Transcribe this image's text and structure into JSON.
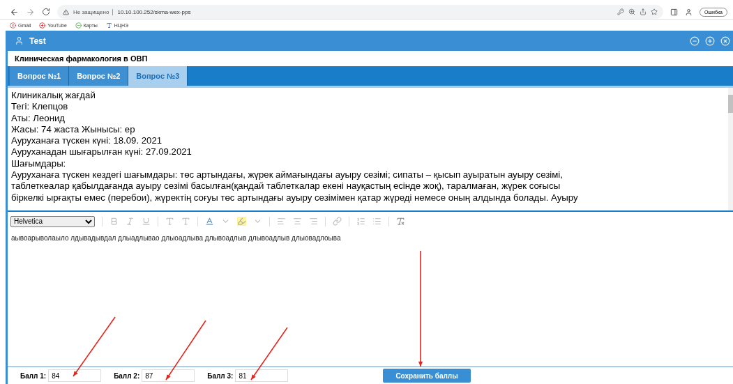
{
  "browser": {
    "security": "Не защищено",
    "url": "10.10.100.252/skma-wex-pps",
    "bookmarks": [
      "Gmail",
      "YouTube",
      "Карты",
      "НЦНЭ"
    ],
    "profile_button": "Ошибка"
  },
  "window": {
    "title": "Test"
  },
  "course_title": "Клиническая фармакология в ОВП",
  "tabs": [
    {
      "label": "Вопрос №1",
      "selected": false
    },
    {
      "label": "Вопрос №2",
      "selected": false
    },
    {
      "label": "Вопрос №3",
      "selected": true
    }
  ],
  "question_lines": [
    "Клиникалық жағдай",
    "Тегі: Клепцов",
    "Аты: Леонид",
    "Жасы: 74 жаста  Жынысы: ер",
    "Ауруханаға түскен күні: 18.09. 2021",
    "Ауруханадан шығарылған күні: 27.09.2021",
    "Шағымдары:",
    "Ауруханаға түскен кездегі шағымдары: төс артындағы, жүрек аймағындағы ауыру сезімі; сипаты – қысып ауыратын ауыру сезімі,",
    "таблеткеалар қабылдағанда  ауыру сезімі басылған(қандай таблеткалар екені науқастың есінде жоқ), таралмаған, жүрек соғысы",
    "біркелкі ырғақты емес (перебои), жүректің соғуы төс артындағы ауыру сезімімен қатар жүреді немесе оның алдында болады.  Ауыру"
  ],
  "editor": {
    "font": "Helvetica",
    "text": "аывоарыволаыло лдывадывдал длыадлывао длыоадлыва длывоадлыв длывоадлыв длыовадлоыва"
  },
  "scores": [
    {
      "label": "Балл 1:",
      "value": "84"
    },
    {
      "label": "Балл 2:",
      "value": "87"
    },
    {
      "label": "Балл 3:",
      "value": "81"
    }
  ],
  "save_button": "Сохранить баллы"
}
